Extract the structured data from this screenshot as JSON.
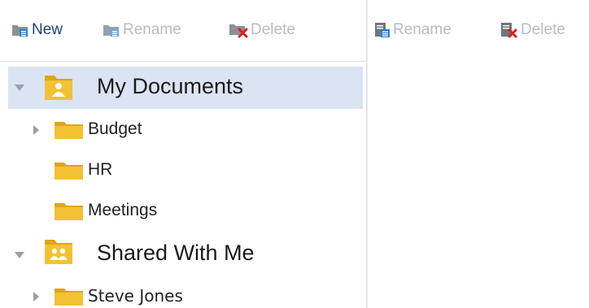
{
  "toolbar_left": {
    "new_label": "New",
    "rename_label": "Rename",
    "delete_label": "Delete"
  },
  "toolbar_right": {
    "rename_label": "Rename",
    "delete_label": "Delete"
  },
  "tree": {
    "my_documents": {
      "label": "My Documents",
      "expanded": true,
      "selected": true,
      "children": [
        {
          "label": "Budget",
          "has_children": true
        },
        {
          "label": "HR",
          "has_children": false
        },
        {
          "label": "Meetings",
          "has_children": false
        }
      ]
    },
    "shared_with_me": {
      "label": "Shared With Me",
      "expanded": true,
      "children": [
        {
          "label": "Steve Jones",
          "has_children": true
        }
      ]
    }
  },
  "colors": {
    "folder": "#f2c233",
    "folder_dark": "#e0a51b",
    "selection": "#dbe4f2",
    "enabled_text": "#1f3f73",
    "disabled_text": "#b6bcc2",
    "delete_x": "#e11d1d",
    "doc_badge": "#2d7fd0"
  },
  "icons": [
    "new-folder-icon",
    "rename-folder-icon",
    "delete-folder-icon",
    "rename-file-icon",
    "delete-file-icon",
    "expand-arrow-icon",
    "collapse-arrow-icon",
    "folder-icon",
    "user-folder-icon",
    "shared-folder-icon"
  ]
}
